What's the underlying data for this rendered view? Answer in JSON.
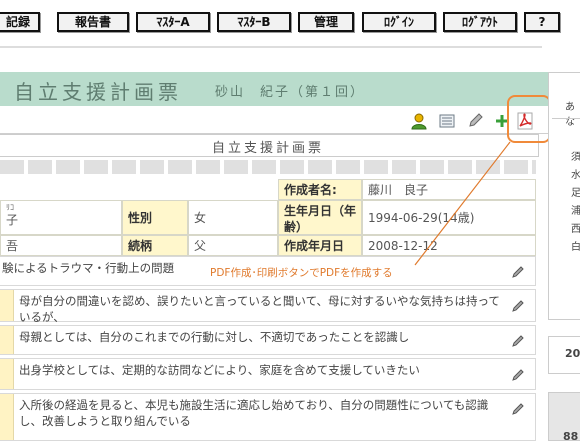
{
  "nav": {
    "items": [
      "記録",
      "報告書",
      "ﾏｽﾀｰA",
      "ﾏｽﾀｰB",
      "管理",
      "ﾛｸﾞｲﾝ",
      "ﾛｸﾞｱｳﾄ",
      "?"
    ]
  },
  "page": {
    "title": "自立支援計画票",
    "subject": "砂山　紀子（第１回）"
  },
  "toolbar": {
    "icons": [
      "person-icon",
      "list-icon",
      "edit-icon",
      "add-icon",
      "pdf-icon"
    ]
  },
  "form": {
    "title": "自立支援計画票",
    "author_label": "作成者名:",
    "author_value": "藤川　良子",
    "name_furigana": "ﾘｺ",
    "name_value": "子",
    "gender_label": "性別",
    "gender_value": "女",
    "birth_label": "生年月日（年齢）",
    "birth_value": "1994-06-29(14歳)",
    "reading_value": "吾",
    "relation_label": "続柄",
    "relation_value": "父",
    "created_label": "作成年月日",
    "created_value": "2008-12-12"
  },
  "rows": [
    "験によるトラウマ・行動上の問題",
    "母が自分の間違いを認め、誤りたいと言っていると聞いて、母に対するいやな気持ちは持っているが、",
    "母親としては、自分のこれまでの行動に対し、不適切であったことを認識し",
    "出身学校としては、定期的な訪問などにより、家庭を含めて支援していきたい",
    "入所後の経過を見ると、本児も施設生活に適応し始めており、自分の問題性についても認識し、改善しようと取り組んでいる"
  ],
  "annotation": "PDF作成･印刷ボタンでPDFを作成する",
  "sidebar": {
    "top_text": "あな",
    "lines": [
      "須",
      "水",
      "足",
      "浦",
      "西",
      "白"
    ],
    "box2_text": "20",
    "box3_text": "88"
  },
  "colors": {
    "title_band": "#b9dccc",
    "label_bg": "#fff7cc",
    "accent": "#f08a3a"
  }
}
